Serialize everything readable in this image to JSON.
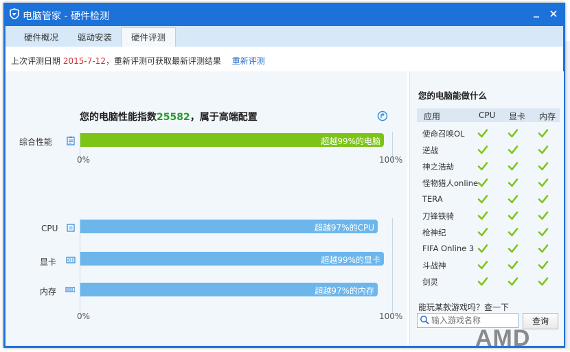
{
  "window": {
    "title": "电脑管家 - 硬件检测"
  },
  "tabs": [
    {
      "label": "硬件概况"
    },
    {
      "label": "驱动安装"
    },
    {
      "label": "硬件评测"
    }
  ],
  "info": {
    "prefix": "上次评测日期",
    "date": "2015-7-12",
    "suffix": "，重新评测可获取最新评测结果",
    "reevaluate": "重新评测"
  },
  "headline": {
    "prefix": "您的电脑性能指数",
    "score": "25582",
    "suffix": "，属于高端配置"
  },
  "overall": {
    "label": "综合性能",
    "percent": 99,
    "text": "超越99%的电脑"
  },
  "axis": {
    "min": "0%",
    "max": "100%"
  },
  "components": [
    {
      "label": "CPU",
      "percent": 97,
      "text": "超越97%的CPU"
    },
    {
      "label": "显卡",
      "percent": 99,
      "text": "超越99%的显卡"
    },
    {
      "label": "内存",
      "percent": 97,
      "text": "超越97%的内存"
    }
  ],
  "right_panel": {
    "title": "您的电脑能做什么",
    "columns": [
      "应用",
      "CPU",
      "显卡",
      "内存"
    ],
    "games": [
      {
        "name": "使命召唤OL"
      },
      {
        "name": "逆战"
      },
      {
        "name": "神之浩劫"
      },
      {
        "name": "怪物猎人online"
      },
      {
        "name": "TERA"
      },
      {
        "name": "刀锋铁骑"
      },
      {
        "name": "枪神纪"
      },
      {
        "name": "FIFA Online 3"
      },
      {
        "name": "斗战神"
      },
      {
        "name": "剑灵"
      }
    ],
    "query_label": "能玩某款游戏吗？查一下",
    "search_placeholder": "输入游戏名称",
    "query_button": "查询"
  },
  "brand_logo": "AMD",
  "colors": {
    "title_bar": "#1d72d9",
    "green_bar": "#7dc419",
    "blue_bar": "#6cb6ec",
    "check": "#7dc419",
    "score": "#2a9a2a",
    "date": "#d23030",
    "link": "#2a6fc8"
  }
}
